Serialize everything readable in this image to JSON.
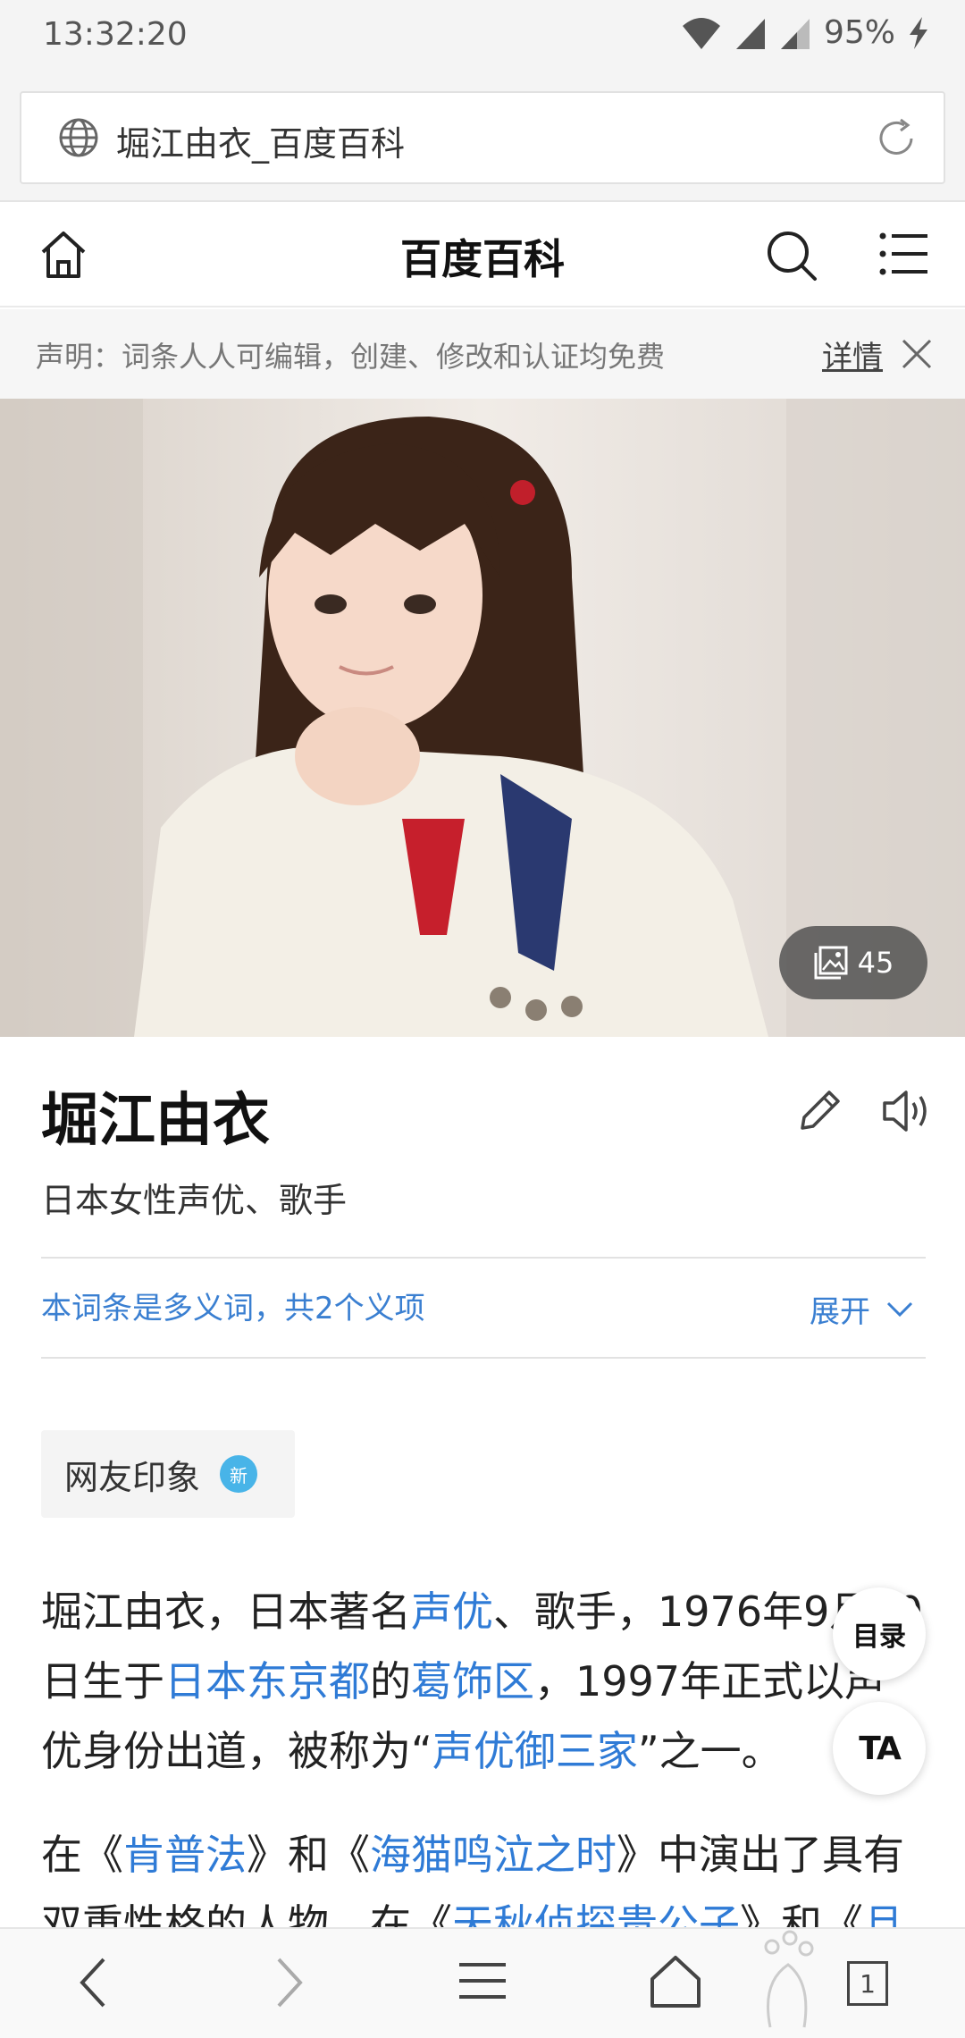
{
  "status_bar": {
    "time": "13:32:20",
    "battery": "95%"
  },
  "url_bar": {
    "title": "堀江由衣_百度百科"
  },
  "header": {
    "title": "百度百科"
  },
  "notice": {
    "text": "声明：词条人人可编辑，创建、修改和认证均免费",
    "link": "详情"
  },
  "hero": {
    "photo_count": "45"
  },
  "entry": {
    "title": "堀江由衣",
    "subtitle": "日本女性声优、歌手",
    "polysemy_text": "本词条是多义词，共2个义项",
    "expand_label": "展开",
    "impression_label": "网友印象",
    "impression_badge": "新"
  },
  "paragraph1": {
    "line1_a": "堀江由衣，日本著名",
    "line1_link": "声优",
    "line1_b": "、歌手，1976年9月20",
    "line2_a": "日生于",
    "line2_link1": "日本东京都",
    "line2_b": "的",
    "line2_link2": "葛饰区",
    "line2_c": "，1997年正式以声",
    "line3_a": "优身份出道，被称为“",
    "line3_link": "声优御三家",
    "line3_b": "”之一。"
  },
  "paragraph2": {
    "line1_a": "在《",
    "line1_link1": "肯普法",
    "line1_b": "》和《",
    "line1_link2": "海猫鸣泣之时",
    "line1_c": "》中演出了具有",
    "line2_a": "双重性格的人物，在《",
    "line2_link1": "天秋侦探贵公子",
    "line2_b": "》和《",
    "line2_link2": "旦"
  },
  "floating": {
    "toc_label": "目录",
    "font_label": "TA"
  },
  "bottom_nav": {
    "tab_count": "1"
  },
  "colors": {
    "link": "#2f7bd6",
    "accent_blue": "#3a7fd1",
    "badge_blue": "#48b4e8"
  }
}
